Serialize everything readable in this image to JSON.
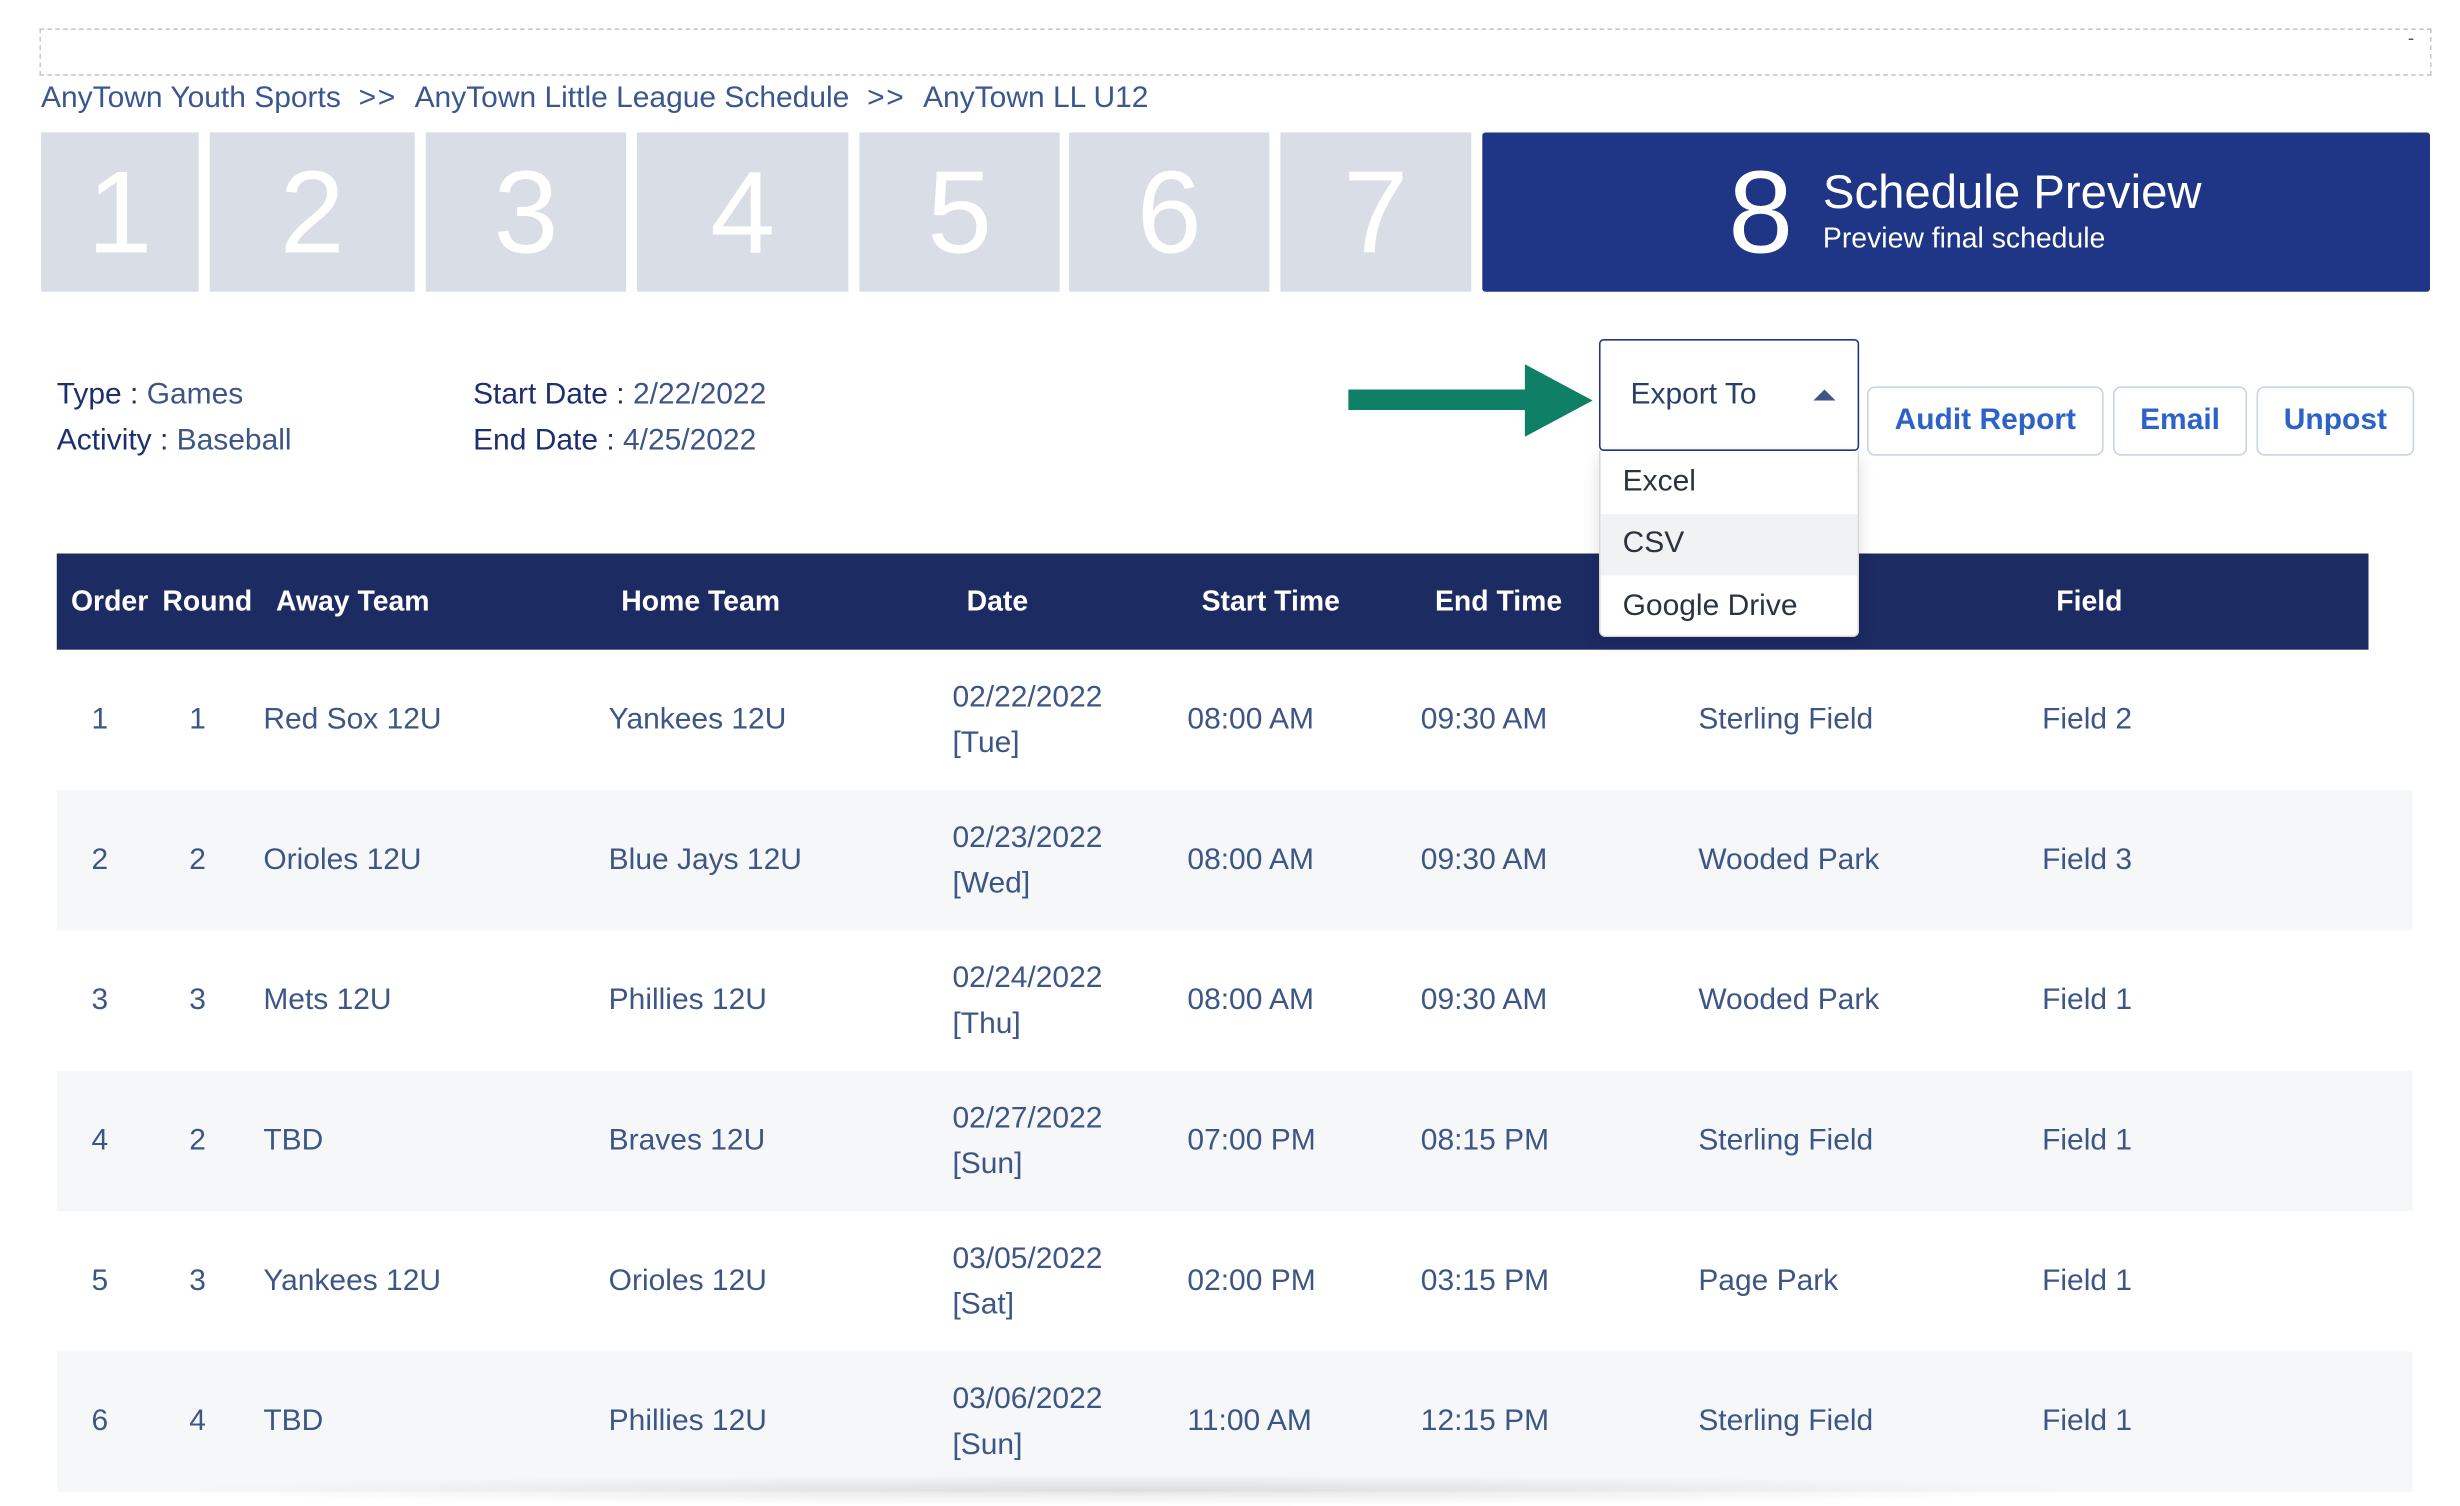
{
  "breadcrumb": {
    "items": [
      "AnyTown Youth Sports",
      "AnyTown Little League Schedule",
      "AnyTown LL U12"
    ],
    "separator": ">>"
  },
  "top_bar": {
    "mark": "-"
  },
  "steps": [
    "1",
    "2",
    "3",
    "4",
    "5",
    "6",
    "7"
  ],
  "active_step": {
    "number": "8",
    "title": "Schedule Preview",
    "subtitle": "Preview final schedule"
  },
  "meta": {
    "type_label": "Type :",
    "type_value": "Games",
    "activity_label": "Activity :",
    "activity_value": "Baseball",
    "start_label": "Start Date :",
    "start_value": "2/22/2022",
    "end_label": "End Date :",
    "end_value": "4/25/2022"
  },
  "export": {
    "label": "Export To",
    "options": [
      "Excel",
      "CSV",
      "Google Drive"
    ],
    "highlighted": "CSV"
  },
  "buttons": {
    "audit": "Audit Report",
    "email": "Email",
    "unpost": "Unpost"
  },
  "table": {
    "headers": {
      "order": "Order",
      "round": "Round",
      "away": "Away Team",
      "home": "Home Team",
      "date": "Date",
      "start": "Start Time",
      "end": "End Time",
      "field": "Field"
    },
    "rows": [
      {
        "order": "1",
        "round": "1",
        "away": "Red Sox 12U",
        "home": "Yankees 12U",
        "date": "02/22/2022",
        "day": "[Tue]",
        "start": "08:00 AM",
        "end": "09:30 AM",
        "venue": "Sterling Field",
        "field": "Field 2"
      },
      {
        "order": "2",
        "round": "2",
        "away": "Orioles 12U",
        "home": "Blue Jays 12U",
        "date": "02/23/2022",
        "day": "[Wed]",
        "start": "08:00 AM",
        "end": "09:30 AM",
        "venue": "Wooded Park",
        "field": "Field 3"
      },
      {
        "order": "3",
        "round": "3",
        "away": "Mets 12U",
        "home": "Phillies 12U",
        "date": "02/24/2022",
        "day": "[Thu]",
        "start": "08:00 AM",
        "end": "09:30 AM",
        "venue": "Wooded Park",
        "field": "Field 1"
      },
      {
        "order": "4",
        "round": "2",
        "away": "TBD",
        "home": "Braves 12U",
        "date": "02/27/2022",
        "day": "[Sun]",
        "start": "07:00 PM",
        "end": "08:15 PM",
        "venue": "Sterling Field",
        "field": "Field 1"
      },
      {
        "order": "5",
        "round": "3",
        "away": "Yankees 12U",
        "home": "Orioles 12U",
        "date": "03/05/2022",
        "day": "[Sat]",
        "start": "02:00 PM",
        "end": "03:15 PM",
        "venue": "Page Park",
        "field": "Field 1"
      },
      {
        "order": "6",
        "round": "4",
        "away": "TBD",
        "home": "Phillies 12U",
        "date": "03/06/2022",
        "day": "[Sun]",
        "start": "11:00 AM",
        "end": "12:15 PM",
        "venue": "Sterling Field",
        "field": "Field 1"
      }
    ]
  },
  "colors": {
    "header_bg": "#1d2b63",
    "active_step_bg": "#1f3586",
    "inactive_step_bg": "#d9dde5",
    "arrow": "#0f7f66",
    "link_blue": "#2d63c8"
  }
}
